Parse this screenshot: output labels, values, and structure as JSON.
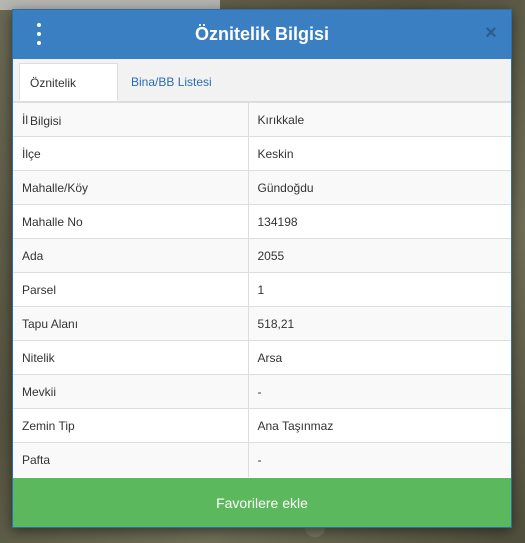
{
  "dialog": {
    "title": "Öznitelik Bilgisi",
    "close_glyph": "×",
    "tabs": [
      {
        "label": "Öznitelik Bilgisi",
        "active": true
      },
      {
        "label": "Bina/BB Listesi",
        "active": false
      }
    ],
    "rows": [
      {
        "key": "İl",
        "value": "Kırıkkale"
      },
      {
        "key": "İlçe",
        "value": "Keskin"
      },
      {
        "key": "Mahalle/Köy",
        "value": "Gündoğdu"
      },
      {
        "key": "Mahalle No",
        "value": "134198"
      },
      {
        "key": "Ada",
        "value": "2055"
      },
      {
        "key": "Parsel",
        "value": "1"
      },
      {
        "key": "Tapu Alanı",
        "value": "518,21"
      },
      {
        "key": "Nitelik",
        "value": "Arsa"
      },
      {
        "key": "Mevkii",
        "value": "-"
      },
      {
        "key": "Zemin Tip",
        "value": "Ana Taşınmaz"
      },
      {
        "key": "Pafta",
        "value": "-"
      }
    ],
    "favorite_button": "Favorilere ekle"
  },
  "colors": {
    "header": "#3a7fc1",
    "button": "#5cb85c",
    "tab_link": "#2a6db3"
  },
  "icons": {
    "menu": "vertical-dots-icon",
    "close": "close-icon"
  }
}
